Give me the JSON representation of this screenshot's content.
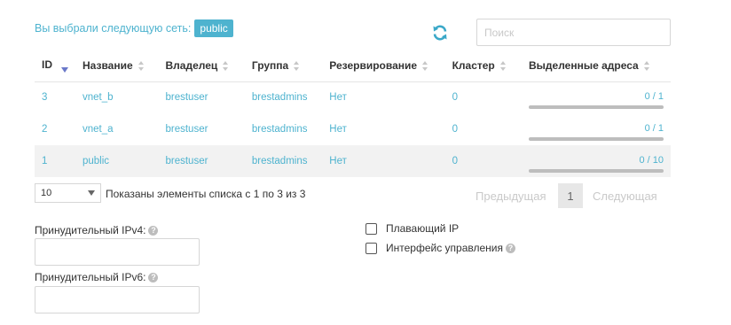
{
  "header": {
    "selected_label": "Вы выбрали следующую сеть:",
    "selected_value": "public",
    "search_placeholder": "Поиск",
    "refresh_icon": "refresh-icon"
  },
  "table": {
    "columns": [
      "ID",
      "Название",
      "Владелец",
      "Группа",
      "Резервирование",
      "Кластер",
      "Выделенные адреса"
    ],
    "rows": [
      {
        "id": "3",
        "name": "vnet_b",
        "owner": "brestuser",
        "group": "brestadmins",
        "reservation": "Нет",
        "cluster": "0",
        "addresses": "0 / 1",
        "used_fraction": 0,
        "selected": false
      },
      {
        "id": "2",
        "name": "vnet_a",
        "owner": "brestuser",
        "group": "brestadmins",
        "reservation": "Нет",
        "cluster": "0",
        "addresses": "0 / 1",
        "used_fraction": 0,
        "selected": false
      },
      {
        "id": "1",
        "name": "public",
        "owner": "brestuser",
        "group": "brestadmins",
        "reservation": "Нет",
        "cluster": "0",
        "addresses": "0 / 10",
        "used_fraction": 0,
        "selected": true
      }
    ]
  },
  "pager": {
    "page_length": "10",
    "info": "Показаны элементы списка с 1 по 3 из 3",
    "prev": "Предыдущая",
    "current": "1",
    "next": "Следующая"
  },
  "form": {
    "ipv4_label": "Принудительный IPv4:",
    "ipv6_label": "Принудительный IPv6:",
    "floating_ip_label": "Плавающий IP",
    "mgmt_iface_label": "Интерфейс управления",
    "help_glyph": "?"
  },
  "colors": {
    "accent": "#4eb3cf",
    "sort_active": "#6a78c9"
  }
}
